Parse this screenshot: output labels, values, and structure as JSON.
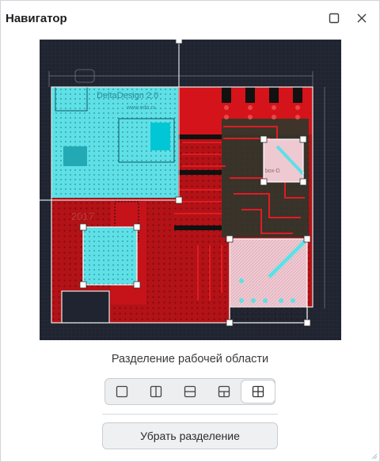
{
  "window": {
    "title": "Навигатор",
    "maximize_icon": "maximize-icon",
    "close_icon": "close-icon"
  },
  "board": {
    "label_top": "DeltaDesign 2.0",
    "label_site": "www.eda.ru",
    "label_year": "2017",
    "label_right": "box-D",
    "accent_cyan": "#5ee0e6",
    "accent_red": "#d4141a",
    "accent_pink": "#eec9d2",
    "background": "#1f2430"
  },
  "split": {
    "caption": "Разделение рабочей области",
    "modes": [
      {
        "name": "single",
        "icon": "single-view-icon",
        "active": false
      },
      {
        "name": "vertical",
        "icon": "vertical-split-icon",
        "active": false
      },
      {
        "name": "horizontal",
        "icon": "horizontal-split-icon",
        "active": false
      },
      {
        "name": "three",
        "icon": "three-way-split-icon",
        "active": false
      },
      {
        "name": "four",
        "icon": "four-way-split-icon",
        "active": true
      }
    ],
    "remove_label": "Убрать разделение"
  }
}
